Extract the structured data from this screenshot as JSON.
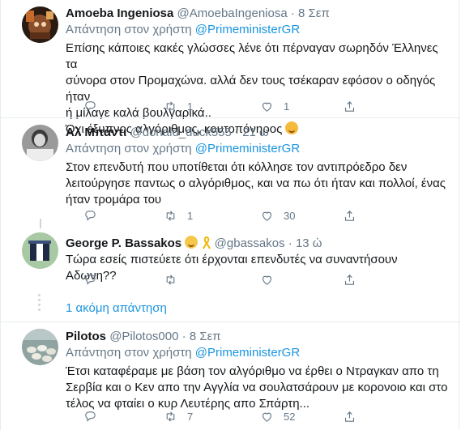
{
  "tweets": [
    {
      "name": "Amoeba Ingeniosa",
      "handle": "@AmoebaIngeniosa",
      "dot": "·",
      "time": "8 Σεπ",
      "reply_prefix": "Απάντηση στον χρήστη",
      "mention": "@PrimeministerGR",
      "lines": [
        "Επίσης κάποιες κακές γλώσσες λένε ότι πέρναγαν σωρηδόν Έλληνες τα",
        "σύνορα στον Προμαχώνα. αλλά δεν τους τσέκαραν εφόσον ο οδηγός ήταν",
        "ή μίλαγε καλά βουλγαρικά..",
        "Όχι έξυπνος αλγόριθμος, κουτοπόνηρος"
      ],
      "reply_count": "",
      "retweet_count": "1",
      "like_count": "1"
    },
    {
      "name": "Αλ Μπάντι",
      "handle": "@donald_duck555",
      "dot": "·",
      "time": "21 ώ",
      "reply_prefix": "Απάντηση στον χρήστη",
      "mention": "@PrimeministerGR",
      "lines": [
        "Στον επενδυτή που υποτίθεται ότι κόλλησε τον αντιπρόεδρο δεν",
        "λειτούργησε παντως ο αλγόριθμος, και να πω ότι ήταν και πολλοί, ένας",
        "ήταν τρομάρα του"
      ],
      "reply_count": "",
      "retweet_count": "1",
      "like_count": "30"
    },
    {
      "name": "George P. Bassakos",
      "handle": "@gbassakos",
      "dot": "·",
      "time": "13 ώ",
      "lines": [
        "Τώρα εσείς πιστεύετε ότι έρχονται επενδυτές να συναντήσουν Αδωνη??"
      ],
      "reply_count": "",
      "retweet_count": "",
      "like_count": ""
    },
    {
      "name": "Pilotos",
      "handle": "@Pilotos000",
      "dot": "·",
      "time": "8 Σεπ",
      "reply_prefix": "Απάντηση στον χρήστη",
      "mention": "@PrimeministerGR",
      "lines": [
        "Έτσι καταφέραμε με βάση τον αλγόριθμο να έρθει ο Ντραγκαν απο τη",
        "Σερβία και ο Κεν απο την Αγγλία να σουλατσάρουν με κορονοιο και στο",
        "τέλος να φταίει ο κυρ Λευτέρης απο Σπάρτη..."
      ],
      "reply_count": "",
      "retweet_count": "7",
      "like_count": "52"
    }
  ],
  "show_more": "1 ακόμη απάντηση",
  "icons": {
    "reply": "reply-icon",
    "retweet": "retweet-icon",
    "like": "heart-icon",
    "share": "share-icon"
  },
  "colors": {
    "link": "#1b95e0",
    "secondary": "#657786",
    "separator": "#e6ecf0"
  }
}
